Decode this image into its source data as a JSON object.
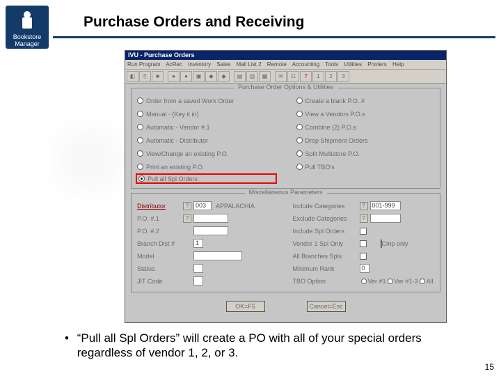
{
  "logo": {
    "line1": "Bookstore",
    "line2": "Manager"
  },
  "slide_title": "Purchase Orders and Receiving",
  "window": {
    "title": "IVU - Purchase Orders",
    "menus": [
      "Run Program",
      "AcRec",
      "Inventory",
      "Sales",
      "Mail List 2",
      "Remote",
      "Accounting",
      "Tools",
      "Utilities",
      "Printers",
      "Help"
    ],
    "options_title": "Purchase Order Options & Utilities",
    "left_radios": [
      "Order from a saved Work Order",
      "Manual - (Key it in)",
      "Automatic - Vendor #.1",
      "Automatic - Distributor",
      "View/Change an existing P.O.",
      "Print an existing P.O.",
      "Pull all Spl Orders"
    ],
    "right_radios": [
      "Create a blank P.O. #",
      "View a Vendors P.O.s",
      "Combine (2) P.O.s",
      "Drop Shipment Orders",
      "Split Multistore P.O.",
      "Pull TBO's"
    ],
    "misc_title": "Miscellaneous Parameters",
    "left_fields": {
      "distributor": {
        "label": "Distributor",
        "code": "003",
        "name": "APPALACHIA"
      },
      "po1": "P.O. #.1",
      "po2": "P.O. #.2",
      "branch": {
        "label": "Branch Dist #",
        "value": "1"
      },
      "model": "Model",
      "status": "Status",
      "jit": "JIT Code"
    },
    "right_fields": {
      "include": {
        "label": "Include Categories",
        "value": "001-999"
      },
      "exclude": "Exclude Categories",
      "include_spl": "Include Spl Orders",
      "v1only": "Vendor 1 Spl Only",
      "allbranch": "All Branches Spls",
      "cmponly": "Cmp only",
      "minrank": "Minimum Rank",
      "tbo": {
        "label": "TBO Option",
        "opts": [
          "Ver #1",
          "Ver #1-3",
          "All"
        ]
      }
    },
    "ok": "OK=F5",
    "cancel": "Cancel=Esc"
  },
  "bullet": "“Pull all Spl Orders” will create a PO with all of your special orders regardless of vendor 1, 2, or 3.",
  "page": "15"
}
